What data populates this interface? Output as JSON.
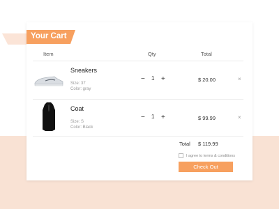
{
  "cart": {
    "title": "Your Cart",
    "headers": {
      "item": "Item",
      "qty": "Qty",
      "total": "Total"
    },
    "items": [
      {
        "name": "Sneakers",
        "size": "Size: 37",
        "color": "Color: gray",
        "qty": "1",
        "price": "$ 20.00",
        "image": "sneaker-image"
      },
      {
        "name": "Coat",
        "size": "Size: S",
        "color": "Color: Black",
        "qty": "1",
        "price": "$ 99.99",
        "image": "coat-image"
      }
    ],
    "qty_minus": "−",
    "qty_plus": "+",
    "remove_symbol": "×",
    "total_label": "Total",
    "total_value": "$ 119.99",
    "agree_text": "I agree to terms & conditions",
    "checkout_label": "Check Out"
  },
  "colors": {
    "accent": "#f7a05f",
    "background_lower": "#f9e2d4"
  }
}
